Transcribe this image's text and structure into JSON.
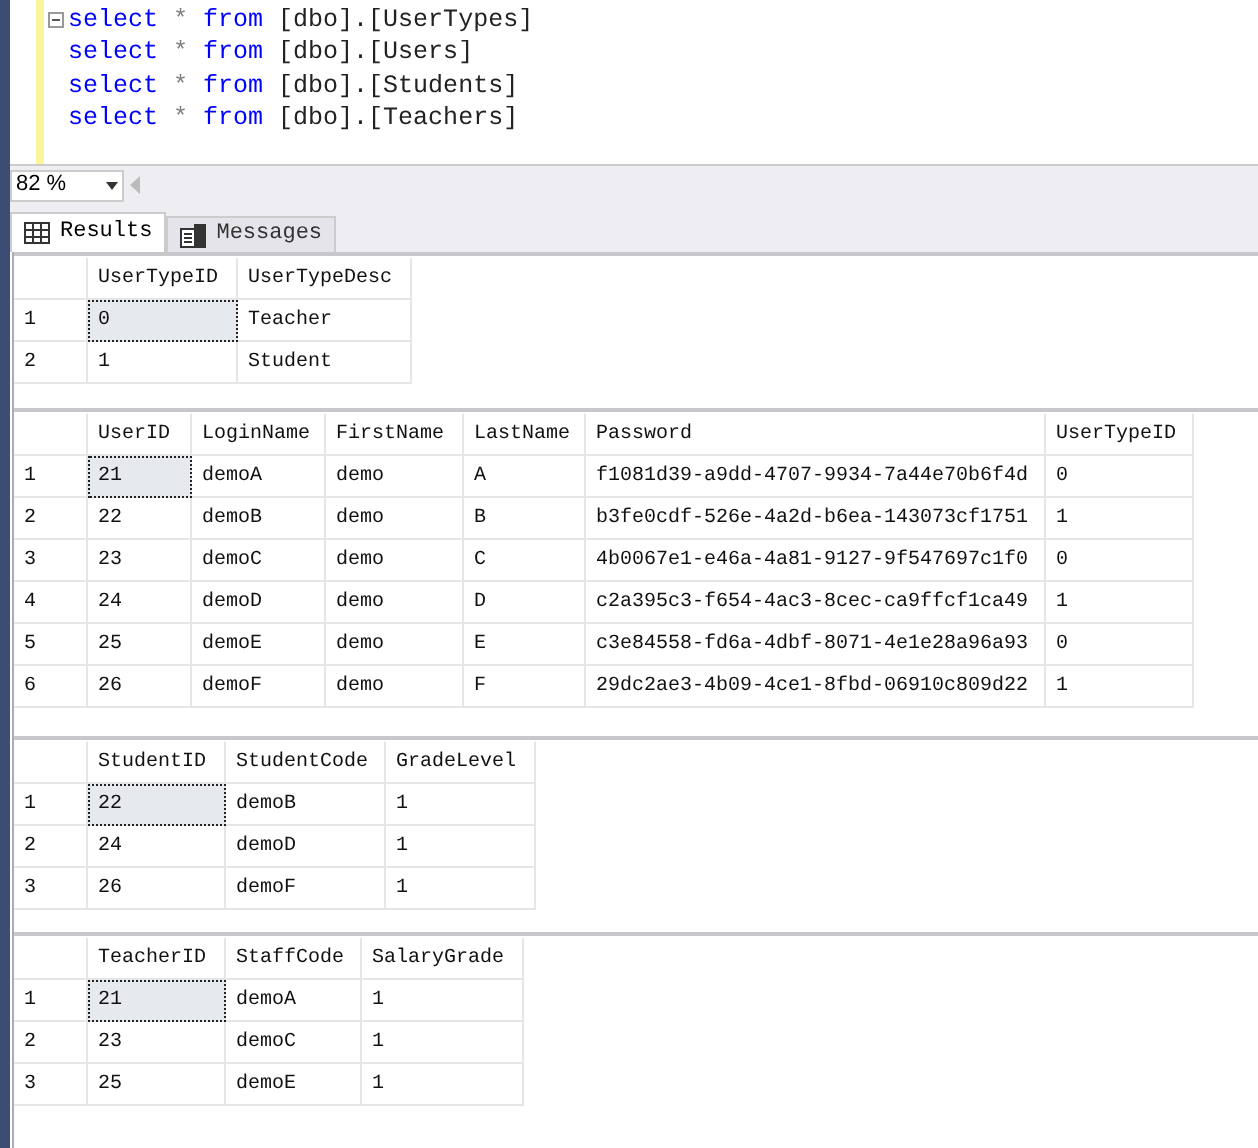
{
  "editor": {
    "lines": [
      [
        {
          "kind": "keyword",
          "text": "select"
        },
        {
          "kind": "operator",
          "text": "*"
        },
        {
          "kind": "keyword",
          "text": "from"
        },
        {
          "kind": "name",
          "text": "[dbo].[UserTypes]"
        }
      ],
      [
        {
          "kind": "keyword",
          "text": "select"
        },
        {
          "kind": "operator",
          "text": "*"
        },
        {
          "kind": "keyword",
          "text": "from"
        },
        {
          "kind": "name",
          "text": "[dbo].[Users]"
        }
      ],
      [
        {
          "kind": "keyword",
          "text": "select"
        },
        {
          "kind": "operator",
          "text": "*"
        },
        {
          "kind": "keyword",
          "text": "from"
        },
        {
          "kind": "name",
          "text": "[dbo].[Students]"
        }
      ],
      [
        {
          "kind": "keyword",
          "text": "select"
        },
        {
          "kind": "operator",
          "text": "*"
        },
        {
          "kind": "keyword",
          "text": "from"
        },
        {
          "kind": "name",
          "text": "[dbo].[Teachers]"
        }
      ]
    ]
  },
  "zoom": {
    "value": "82 %"
  },
  "tabs": [
    {
      "label": "Results",
      "selected": true
    },
    {
      "label": "Messages",
      "selected": false
    }
  ],
  "grids": [
    {
      "columns": [
        "UserTypeID",
        "UserTypeDesc"
      ],
      "rows": [
        {
          "num": "1",
          "focused": true,
          "cells": [
            "0",
            "Teacher"
          ]
        },
        {
          "num": "2",
          "focused": false,
          "cells": [
            "1",
            "Student"
          ]
        }
      ]
    },
    {
      "columns": [
        "UserID",
        "LoginName",
        "FirstName",
        "LastName",
        "Password",
        "UserTypeID"
      ],
      "rows": [
        {
          "num": "1",
          "focused": true,
          "cells": [
            "21",
            "demoA",
            "demo",
            "A",
            "f1081d39-a9dd-4707-9934-7a44e70b6f4d",
            "0"
          ]
        },
        {
          "num": "2",
          "focused": false,
          "cells": [
            "22",
            "demoB",
            "demo",
            "B",
            "b3fe0cdf-526e-4a2d-b6ea-143073cf1751",
            "1"
          ]
        },
        {
          "num": "3",
          "focused": false,
          "cells": [
            "23",
            "demoC",
            "demo",
            "C",
            "4b0067e1-e46a-4a81-9127-9f547697c1f0",
            "0"
          ]
        },
        {
          "num": "4",
          "focused": false,
          "cells": [
            "24",
            "demoD",
            "demo",
            "D",
            "c2a395c3-f654-4ac3-8cec-ca9ffcf1ca49",
            "1"
          ]
        },
        {
          "num": "5",
          "focused": false,
          "cells": [
            "25",
            "demoE",
            "demo",
            "E",
            "c3e84558-fd6a-4dbf-8071-4e1e28a96a93",
            "0"
          ]
        },
        {
          "num": "6",
          "focused": false,
          "cells": [
            "26",
            "demoF",
            "demo",
            "F",
            "29dc2ae3-4b09-4ce1-8fbd-06910c809d22",
            "1"
          ]
        }
      ]
    },
    {
      "columns": [
        "StudentID",
        "StudentCode",
        "GradeLevel"
      ],
      "rows": [
        {
          "num": "1",
          "focused": true,
          "cells": [
            "22",
            "demoB",
            "1"
          ]
        },
        {
          "num": "2",
          "focused": false,
          "cells": [
            "24",
            "demoD",
            "1"
          ]
        },
        {
          "num": "3",
          "focused": false,
          "cells": [
            "26",
            "demoF",
            "1"
          ]
        }
      ]
    },
    {
      "columns": [
        "TeacherID",
        "StaffCode",
        "SalaryGrade"
      ],
      "rows": [
        {
          "num": "1",
          "focused": true,
          "cells": [
            "21",
            "demoA",
            "1"
          ]
        },
        {
          "num": "2",
          "focused": false,
          "cells": [
            "23",
            "demoC",
            "1"
          ]
        },
        {
          "num": "3",
          "focused": false,
          "cells": [
            "25",
            "demoE",
            "1"
          ]
        }
      ]
    }
  ]
}
